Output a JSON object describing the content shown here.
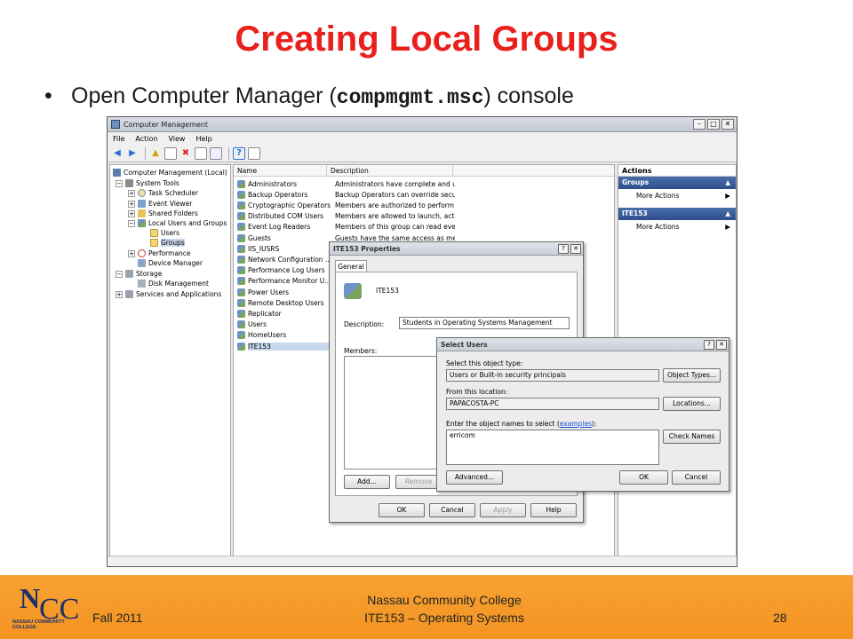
{
  "slide": {
    "title": "Creating Local Groups",
    "bullet_prefix": "Open Computer Manager (",
    "bullet_code": "compmgmt.msc",
    "bullet_suffix": ") console"
  },
  "window": {
    "title": "Computer Management",
    "menu": [
      "File",
      "Action",
      "View",
      "Help"
    ],
    "toolbar_icons": [
      "back-arrow-icon",
      "forward-arrow-icon",
      "up-folder-icon",
      "show-hide-tree-icon",
      "delete-icon",
      "properties-icon",
      "export-icon",
      "help-icon",
      "details-view-icon"
    ]
  },
  "tree": [
    {
      "label": "Computer Management (Local)",
      "toggle": "",
      "icon": "computer-icon"
    },
    {
      "label": "System Tools",
      "toggle": "−",
      "icon": "tools-icon"
    },
    {
      "label": "Task Scheduler",
      "toggle": "+",
      "icon": "clock-icon"
    },
    {
      "label": "Event Viewer",
      "toggle": "+",
      "icon": "event-viewer-icon"
    },
    {
      "label": "Shared Folders",
      "toggle": "+",
      "icon": "shared-folder-icon"
    },
    {
      "label": "Local Users and Groups",
      "toggle": "−",
      "icon": "users-icon"
    },
    {
      "label": "Users",
      "toggle": "",
      "icon": "folder-icon"
    },
    {
      "label": "Groups",
      "toggle": "",
      "icon": "folder-icon"
    },
    {
      "label": "Performance",
      "toggle": "+",
      "icon": "performance-icon"
    },
    {
      "label": "Device Manager",
      "toggle": "",
      "icon": "device-manager-icon"
    },
    {
      "label": "Storage",
      "toggle": "−",
      "icon": "storage-icon"
    },
    {
      "label": "Disk Management",
      "toggle": "",
      "icon": "disk-icon"
    },
    {
      "label": "Services and Applications",
      "toggle": "+",
      "icon": "services-icon"
    }
  ],
  "list": {
    "headers": [
      "Name",
      "Description"
    ],
    "rows": [
      {
        "name": "Administrators",
        "desc": "Administrators have complete and u..."
      },
      {
        "name": "Backup Operators",
        "desc": "Backup Operators can override secu..."
      },
      {
        "name": "Cryptographic Operators",
        "desc": "Members are authorized to perform ..."
      },
      {
        "name": "Distributed COM Users",
        "desc": "Members are allowed to launch, acti..."
      },
      {
        "name": "Event Log Readers",
        "desc": "Members of this group can read eve..."
      },
      {
        "name": "Guests",
        "desc": "Guests have the same access as me..."
      },
      {
        "name": "IIS_IUSRS",
        "desc": ""
      },
      {
        "name": "Network Configuration ...",
        "desc": ""
      },
      {
        "name": "Performance Log Users",
        "desc": ""
      },
      {
        "name": "Performance Monitor U...",
        "desc": ""
      },
      {
        "name": "Power Users",
        "desc": ""
      },
      {
        "name": "Remote Desktop Users",
        "desc": ""
      },
      {
        "name": "Replicator",
        "desc": ""
      },
      {
        "name": "Users",
        "desc": ""
      },
      {
        "name": "HomeUsers",
        "desc": ""
      },
      {
        "name": "ITE153",
        "desc": ""
      }
    ]
  },
  "actions": {
    "header": "Actions",
    "sections": [
      {
        "title": "Groups",
        "item": "More Actions"
      },
      {
        "title": "ITE153",
        "item": "More Actions"
      }
    ]
  },
  "properties": {
    "title": "ITE153 Properties",
    "tab": "General",
    "group_name": "ITE153",
    "description_label": "Description:",
    "description_value": "Students in Operating Systems Management",
    "members_label": "Members:",
    "add": "Add...",
    "remove": "Remove",
    "ok": "OK",
    "cancel": "Cancel",
    "apply": "Apply",
    "help": "Help"
  },
  "select_users": {
    "title": "Select Users",
    "object_type_label": "Select this object type:",
    "object_type_value": "Users or Built-in security principals",
    "object_types_btn": "Object Types...",
    "location_label": "From this location:",
    "location_value": "PAPACOSTA-PC",
    "locations_btn": "Locations...",
    "names_label": "Enter the object names to select (",
    "examples_link": "examples",
    "names_label_end": "):",
    "names_value": "erricom",
    "check_names_btn": "Check Names",
    "advanced_btn": "Advanced...",
    "ok": "OK",
    "cancel": "Cancel"
  },
  "footer": {
    "left": "Fall 2011",
    "center_line1": "Nassau Community College",
    "center_line2": "ITE153 – Operating Systems",
    "page": "28",
    "logo_letters_1": "N",
    "logo_letters_2": "CC",
    "logo_text": "NASSAU COMMUNITY COLLEGE",
    "bar_color": "#f39321"
  }
}
